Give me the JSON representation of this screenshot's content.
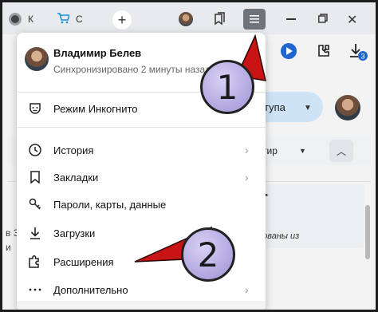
{
  "titlebar": {
    "tabs": [
      {
        "label": "К",
        "icon": "wordpress-icon"
      },
      {
        "label": "С",
        "icon": "cart-icon"
      }
    ],
    "new_tab_label": "+",
    "close_label": "✕"
  },
  "menu": {
    "profile": {
      "name": "Владимир Белев",
      "sync_status": "Синхронизировано 2 минуты назад"
    },
    "items": [
      {
        "label": "Режим Инкогнито",
        "icon": "incognito-icon",
        "has_submenu": false
      },
      {
        "label": "История",
        "icon": "history-icon",
        "has_submenu": true
      },
      {
        "label": "Закладки",
        "icon": "bookmark-icon",
        "has_submenu": true
      },
      {
        "label": "Пароли, карты, данные",
        "icon": "key-icon",
        "has_submenu": false
      },
      {
        "label": "Загрузки",
        "icon": "download-icon",
        "has_submenu": false
      },
      {
        "label": "Расширения",
        "icon": "puzzle-icon",
        "has_submenu": false
      },
      {
        "label": "Дополнительно",
        "icon": "more-dots-icon",
        "has_submenu": true
      }
    ]
  },
  "background": {
    "pill_label": "тупа",
    "filter_label": "тир",
    "card_text": "рованы из",
    "left_text_1": "в 3",
    "left_text_2": "и"
  },
  "annotations": {
    "step1": "1",
    "step2": "2"
  },
  "colors": {
    "menu_button_bg": "#6f747b",
    "badge_fill": "#b8aee3",
    "arrow_red": "#c81414"
  }
}
